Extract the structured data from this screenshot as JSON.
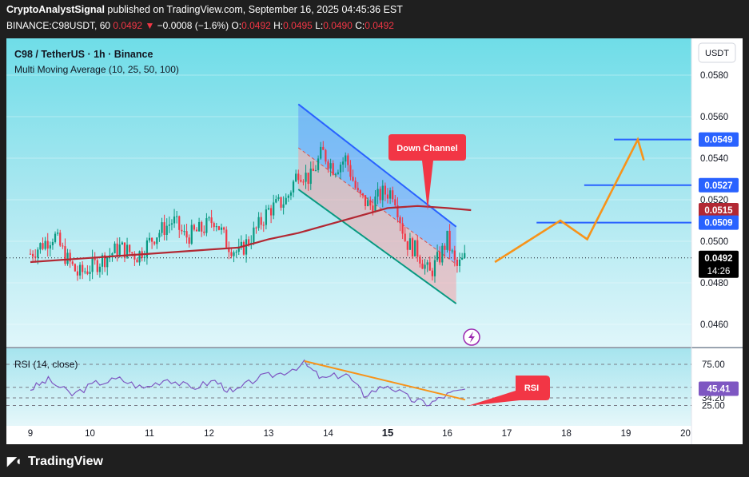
{
  "header": {
    "author": "CryptoAnalystSignal",
    "published": "published on TradingView.com, September 16, 2025 04:45:36 EST",
    "symbol": "BINANCE:C98USDT, 60",
    "last": "0.0492",
    "change_arrow": "▼",
    "change": "−0.0008 (−1.6%)",
    "o_label": "O:",
    "o": "0.0492",
    "h_label": "H:",
    "h": "0.0495",
    "l_label": "L:",
    "l": "0.0490",
    "c_label": "C:",
    "c": "0.0492"
  },
  "legend": {
    "title": "C98 / TetherUS · 1h · Binance",
    "indicator": "Multi Moving Average (10, 25, 50, 100)"
  },
  "currency_button": "USDT",
  "annotations": {
    "down_channel": "Down Channel",
    "rsi": "RSI"
  },
  "price_axis": {
    "ticks": [
      "0.0580",
      "0.0560",
      "0.0540",
      "0.0520",
      "0.0500",
      "0.0480",
      "0.0460"
    ],
    "badges": [
      {
        "label": "0.0549",
        "color": "#2962ff"
      },
      {
        "label": "0.0527",
        "color": "#2962ff"
      },
      {
        "label": "0.0515",
        "color": "#b22833"
      },
      {
        "label": "0.0509",
        "color": "#2962ff"
      },
      {
        "label": "0.0492",
        "color": "#000000"
      }
    ],
    "countdown": "14:26"
  },
  "rsi_pane": {
    "label": "RSI (14, close)",
    "ticks": [
      "75.00",
      "47.09",
      "34.20",
      "25.00"
    ],
    "badge": "45.41",
    "badge_color": "#7e57c2"
  },
  "time_axis": {
    "ticks": [
      "9",
      "10",
      "11",
      "12",
      "13",
      "14",
      "15",
      "16",
      "17",
      "18",
      "19",
      "20"
    ]
  },
  "colors": {
    "bull": "#089981",
    "bear": "#f23645",
    "ma": "#b22833",
    "channel_top": "#2962ff",
    "channel_bottom": "#089981",
    "projection": "#f7931a",
    "rsi_line": "#7e57c2",
    "level": "#2962ff"
  },
  "footer": {
    "brand": "TradingView",
    "logo_icon": "tradingview-logo-icon"
  },
  "chart_data": {
    "type": "candlestick",
    "title": "C98 / TetherUS · 1h · Binance",
    "timeframe": "1h",
    "x_axis_labels": [
      "9",
      "10",
      "11",
      "12",
      "13",
      "14",
      "15",
      "16",
      "17",
      "18",
      "19",
      "20"
    ],
    "y_range": [
      0.0452,
      0.0596
    ],
    "closes_approx": [
      {
        "day": 9.0,
        "close": 0.0494
      },
      {
        "day": 9.4,
        "close": 0.0503
      },
      {
        "day": 9.6,
        "close": 0.0492
      },
      {
        "day": 9.8,
        "close": 0.0484
      },
      {
        "day": 10.1,
        "close": 0.0489
      },
      {
        "day": 10.5,
        "close": 0.0497
      },
      {
        "day": 10.8,
        "close": 0.0493
      },
      {
        "day": 11.1,
        "close": 0.0503
      },
      {
        "day": 11.4,
        "close": 0.051
      },
      {
        "day": 11.6,
        "close": 0.0502
      },
      {
        "day": 11.9,
        "close": 0.0506
      },
      {
        "day": 12.1,
        "close": 0.0511
      },
      {
        "day": 12.3,
        "close": 0.0499
      },
      {
        "day": 12.5,
        "close": 0.0494
      },
      {
        "day": 12.8,
        "close": 0.0506
      },
      {
        "day": 13.0,
        "close": 0.0515
      },
      {
        "day": 13.3,
        "close": 0.052
      },
      {
        "day": 13.5,
        "close": 0.0534
      },
      {
        "day": 13.7,
        "close": 0.053
      },
      {
        "day": 13.9,
        "close": 0.0543
      },
      {
        "day": 14.1,
        "close": 0.0535
      },
      {
        "day": 14.3,
        "close": 0.054
      },
      {
        "day": 14.5,
        "close": 0.0522
      },
      {
        "day": 14.7,
        "close": 0.0517
      },
      {
        "day": 14.9,
        "close": 0.0523
      },
      {
        "day": 15.1,
        "close": 0.0524
      },
      {
        "day": 15.3,
        "close": 0.05
      },
      {
        "day": 15.5,
        "close": 0.0495
      },
      {
        "day": 15.7,
        "close": 0.0484
      },
      {
        "day": 15.9,
        "close": 0.0494
      },
      {
        "day": 16.0,
        "close": 0.0501
      },
      {
        "day": 16.15,
        "close": 0.0487
      },
      {
        "day": 16.3,
        "close": 0.0492
      }
    ],
    "moving_average_100": [
      {
        "day": 9.0,
        "value": 0.049
      },
      {
        "day": 10.0,
        "value": 0.0492
      },
      {
        "day": 11.0,
        "value": 0.0494
      },
      {
        "day": 12.0,
        "value": 0.0496
      },
      {
        "day": 12.5,
        "value": 0.0497
      },
      {
        "day": 13.0,
        "value": 0.0501
      },
      {
        "day": 13.5,
        "value": 0.0504
      },
      {
        "day": 14.0,
        "value": 0.0508
      },
      {
        "day": 14.5,
        "value": 0.0512
      },
      {
        "day": 15.0,
        "value": 0.0516
      },
      {
        "day": 15.5,
        "value": 0.0517
      },
      {
        "day": 16.0,
        "value": 0.0516
      },
      {
        "day": 16.4,
        "value": 0.0515
      }
    ],
    "channel": {
      "upper": [
        {
          "day": 13.5,
          "price": 0.0566
        },
        {
          "day": 16.15,
          "price": 0.0507
        }
      ],
      "lower": [
        {
          "day": 13.5,
          "price": 0.0525
        },
        {
          "day": 16.15,
          "price": 0.047
        }
      ],
      "mid": [
        {
          "day": 13.5,
          "price": 0.0545
        },
        {
          "day": 16.15,
          "price": 0.0489
        }
      ]
    },
    "projection": [
      {
        "day": 16.8,
        "price": 0.049
      },
      {
        "day": 17.9,
        "price": 0.051
      },
      {
        "day": 18.35,
        "price": 0.0501
      },
      {
        "day": 19.2,
        "price": 0.0549
      },
      {
        "day": 19.3,
        "price": 0.0539
      }
    ],
    "levels": [
      {
        "price": 0.0549,
        "from_day": 18.8
      },
      {
        "price": 0.0527,
        "from_day": 18.3
      },
      {
        "price": 0.0509,
        "from_day": 17.5
      }
    ],
    "rsi": {
      "levels": [
        75.0,
        47.09,
        34.2,
        25.0
      ],
      "current": 45.41,
      "values_approx": [
        {
          "day": 9.0,
          "v": 45
        },
        {
          "day": 9.3,
          "v": 56
        },
        {
          "day": 9.7,
          "v": 38
        },
        {
          "day": 10.1,
          "v": 52
        },
        {
          "day": 10.5,
          "v": 57
        },
        {
          "day": 10.9,
          "v": 46
        },
        {
          "day": 11.3,
          "v": 58
        },
        {
          "day": 11.7,
          "v": 46
        },
        {
          "day": 12.1,
          "v": 55
        },
        {
          "day": 12.4,
          "v": 40
        },
        {
          "day": 12.8,
          "v": 58
        },
        {
          "day": 13.2,
          "v": 64
        },
        {
          "day": 13.6,
          "v": 76
        },
        {
          "day": 13.9,
          "v": 57
        },
        {
          "day": 14.3,
          "v": 64
        },
        {
          "day": 14.6,
          "v": 38
        },
        {
          "day": 15.0,
          "v": 50
        },
        {
          "day": 15.4,
          "v": 32
        },
        {
          "day": 15.7,
          "v": 27
        },
        {
          "day": 16.0,
          "v": 38
        },
        {
          "day": 16.3,
          "v": 45
        }
      ],
      "trendline": [
        {
          "day": 13.6,
          "v": 79
        },
        {
          "day": 16.3,
          "v": 32
        }
      ]
    }
  }
}
